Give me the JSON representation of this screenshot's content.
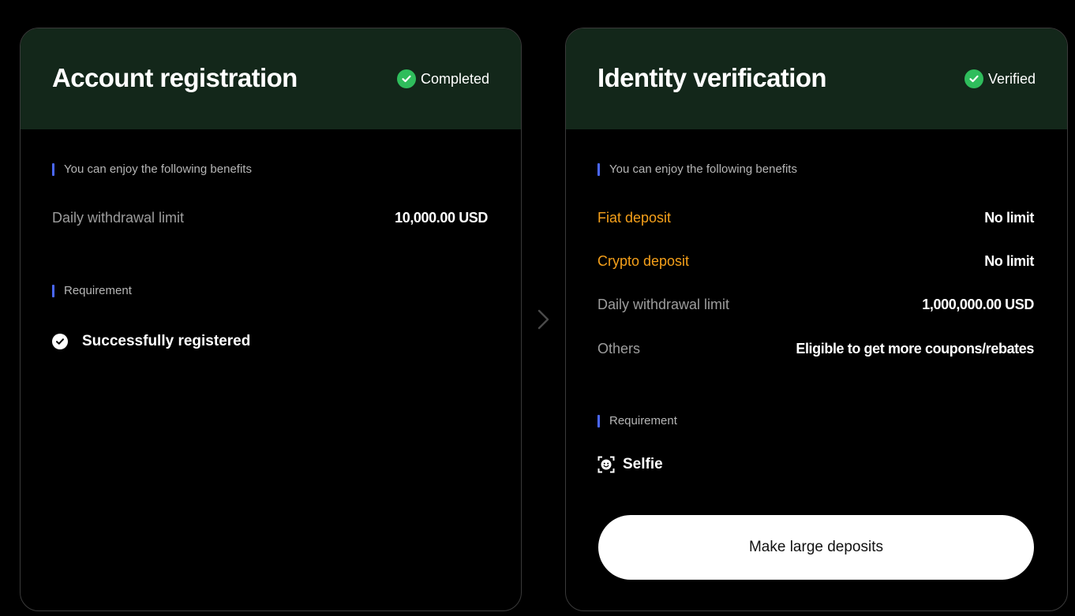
{
  "cards": [
    {
      "title": "Account registration",
      "status": "Completed",
      "benefits_label": "You can enjoy the following benefits",
      "benefits": [
        {
          "label": "Daily withdrawal limit",
          "value": "10,000.00 USD",
          "highlight": false
        }
      ],
      "requirement_label": "Requirement",
      "requirement": {
        "icon": "check-circle-icon",
        "text": "Successfully registered"
      }
    },
    {
      "title": "Identity verification",
      "status": "Verified",
      "benefits_label": "You can enjoy the following benefits",
      "benefits": [
        {
          "label": "Fiat deposit",
          "value": "No limit",
          "highlight": true
        },
        {
          "label": "Crypto deposit",
          "value": "No limit",
          "highlight": true
        },
        {
          "label": "Daily withdrawal limit",
          "value": "1,000,000.00 USD",
          "highlight": false
        },
        {
          "label": "Others",
          "value": "Eligible to get more coupons/rebates",
          "highlight": false
        }
      ],
      "requirement_label": "Requirement",
      "requirement": {
        "icon": "selfie-icon",
        "text": "Selfie"
      },
      "cta_label": "Make large deposits"
    }
  ],
  "colors": {
    "header_bg": "#13271a",
    "status_green": "#2fbd5c",
    "accent_bar": "#4a67ff",
    "highlight_orange": "#f5a01a"
  }
}
